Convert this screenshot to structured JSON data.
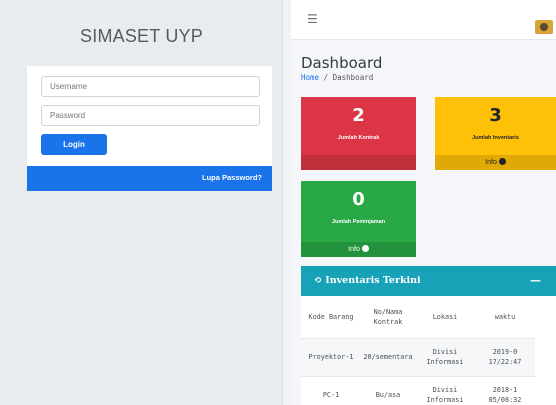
{
  "login": {
    "app_title": "SIMASET UYP",
    "username_placeholder": "Username",
    "password_placeholder": "Password",
    "login_button": "Login",
    "forgot_link": "Lupa Password?"
  },
  "header": {
    "menu_icon": "hamburger-icon",
    "avatar_icon": "user-avatar"
  },
  "page": {
    "title": "Dashboard",
    "breadcrumb": {
      "home": "Home",
      "separator": "/",
      "current": "Dashboard"
    }
  },
  "stats": [
    {
      "value": "2",
      "label": "Jumlah Kontrak",
      "color": "#dc3545"
    },
    {
      "value": "3",
      "label": "Jumlah Inventaris",
      "footer": "Info",
      "color": "#ffc107"
    },
    {
      "value": "0",
      "label": "Jumlah Peminjaman",
      "footer": "Info",
      "color": "#28a745"
    }
  ],
  "inventory_card": {
    "title": "Inventaris Terkini",
    "title_icon": "history-icon",
    "collapse_icon": "minus-icon",
    "color": "#17a2b8",
    "columns": [
      "Kode Barang",
      "No/Nama Kontrak",
      "Lokasi",
      "waktu"
    ],
    "rows": [
      {
        "kode": "Proyektor-1",
        "kontrak": "20/sementara",
        "lokasi": "Divisi Informasi",
        "waktu": "2019-0 17/22:47"
      },
      {
        "kode": "PC-1",
        "kontrak": "Bu/asa",
        "lokasi": "Divisi Informasi",
        "waktu": "2018-1 05/08:32"
      }
    ]
  }
}
